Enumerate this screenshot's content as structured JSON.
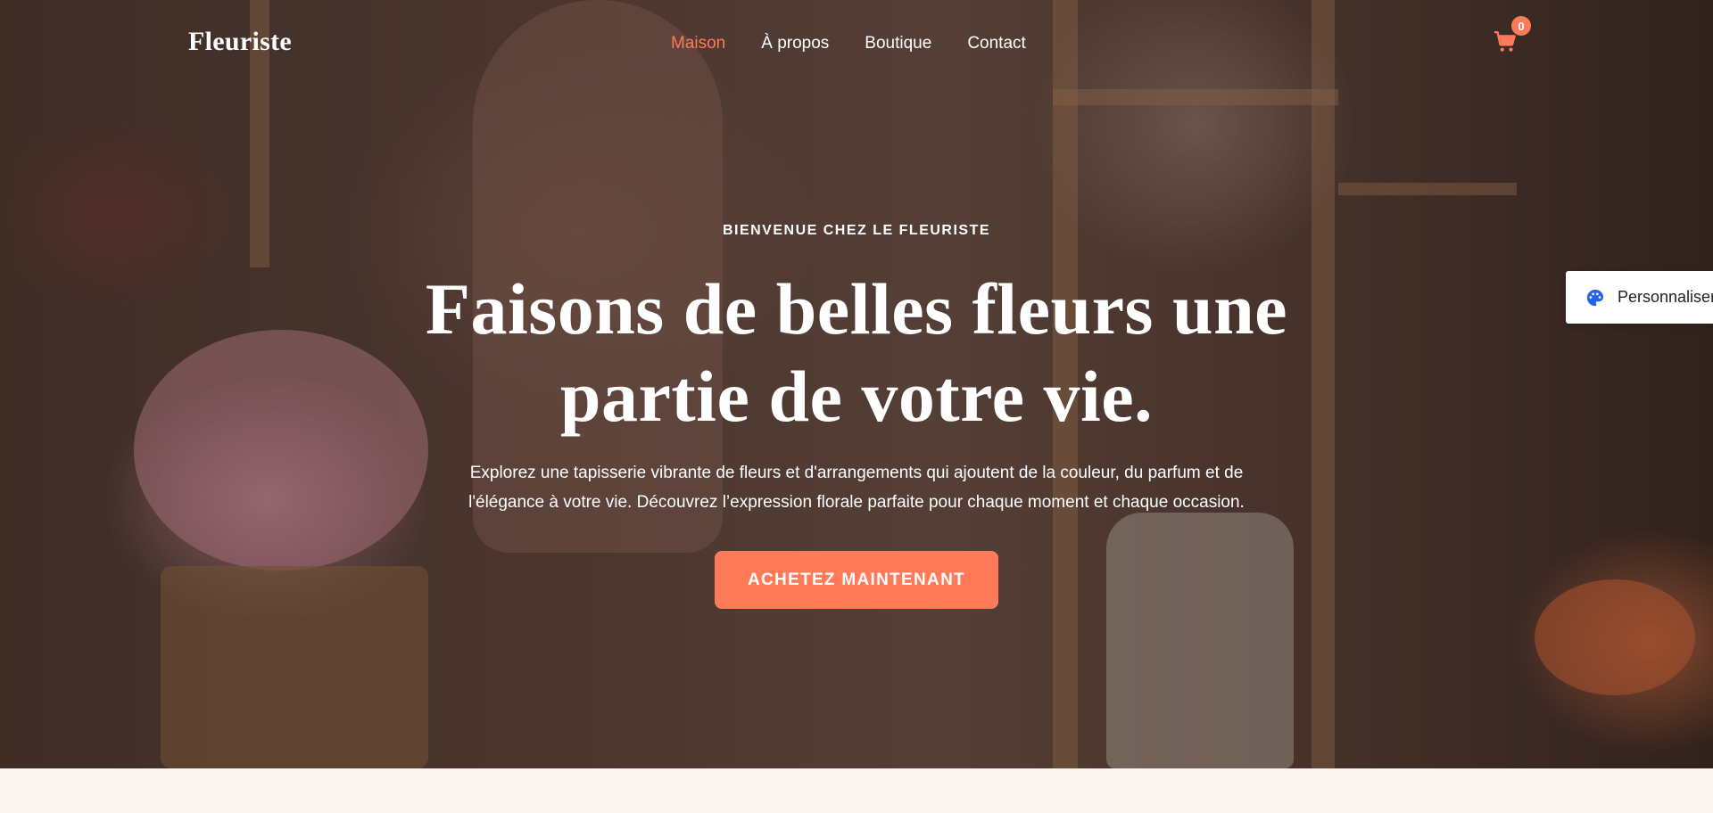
{
  "brand": {
    "name": "Fleuriste",
    "accent_color": "#ff7a59"
  },
  "nav": {
    "items": [
      {
        "label": "Maison",
        "active": true
      },
      {
        "label": "À propos",
        "active": false
      },
      {
        "label": "Boutique",
        "active": false
      },
      {
        "label": "Contact",
        "active": false
      }
    ]
  },
  "cart": {
    "icon": "cart-icon",
    "count": "0"
  },
  "customize": {
    "icon": "palette-icon",
    "label": "Personnaliser"
  },
  "hero": {
    "eyebrow": "BIENVENUE CHEZ LE FLEURISTE",
    "headline_line1": "Faisons de belles fleurs une",
    "headline_line2": "partie de votre vie.",
    "description_line1": "Explorez une tapisserie vibrante de fleurs et d'arrangements qui ajoutent de la couleur, du parfum et de",
    "description_line2": "l'élégance à votre vie. Découvrez l’expression florale parfaite pour chaque moment et chaque occasion.",
    "cta_label": "ACHETEZ MAINTENANT"
  }
}
